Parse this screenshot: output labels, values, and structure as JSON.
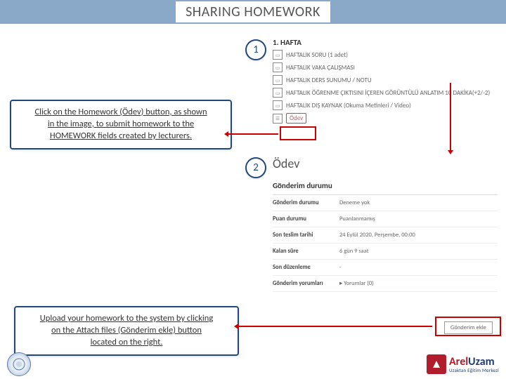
{
  "title": "SHARING HOMEWORK",
  "badges": {
    "one": "1",
    "two": "2"
  },
  "callout1_a": "Click on the Homework (Ödev) button, as shown",
  "callout1_b": "in the image, to submit homework to the",
  "callout1_c": "HOMEWORK fields created by lecturers.",
  "callout2_a": "Upload your homework to the system by clicking",
  "callout2_b": "on the Attach files (Gönderim ekle) button",
  "callout2_c": "located on the right.",
  "week": {
    "heading": "1. HAFTA",
    "items": [
      "HAFTALIK SORU (1 adet)",
      "HAFTALIK VAKA ÇALIŞMASI",
      "HAFTALIK DERS SUNUMU / NOTU",
      "HAFTALIK ÖĞRENME ÇIKTISINI İÇEREN GÖRÜNTÜLÜ ANLATIM 10 DAKİKA(+2/-2)",
      "HAFTALIK DIŞ KAYNAK (Okuma Metinleri / Video)",
      "Ödev"
    ]
  },
  "odev": {
    "title": "Ödev",
    "section": "Gönderim durumu",
    "rows": [
      {
        "k": "Gönderim durumu",
        "v": "Deneme yok"
      },
      {
        "k": "Puan durumu",
        "v": "Puanlanmamış"
      },
      {
        "k": "Son teslim tarihi",
        "v": "24 Eylül 2020, Perşembe, 00:00"
      },
      {
        "k": "Kalan süre",
        "v": "6 gün 9 saat"
      },
      {
        "k": "Son düzenleme",
        "v": "-"
      },
      {
        "k": "Gönderim yorumları",
        "v": "▸ Yorumlar (0)"
      }
    ],
    "button": "Gönderim ekle"
  },
  "brand": {
    "red": "Arel",
    "blue": "Uzam",
    "sub": "Uzaktan Eğitim Merkezi"
  }
}
